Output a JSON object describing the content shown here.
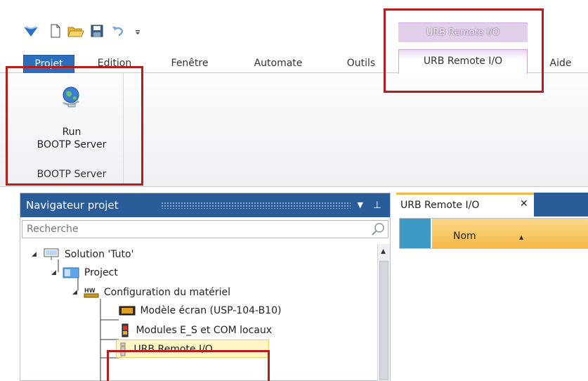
{
  "window": {
    "context_tab_group": "URB Remote I/O"
  },
  "ribbon_tabs": [
    {
      "label": "Projet"
    },
    {
      "label": "Edition"
    },
    {
      "label": "Fenêtre"
    },
    {
      "label": "Automate"
    },
    {
      "label": "Outils"
    },
    {
      "label": "URB Remote I/O"
    },
    {
      "label": "Aide"
    }
  ],
  "ribbon": {
    "button_line1": "Run",
    "button_line2": "BOOTP Server",
    "group_label": "BOOTP Server"
  },
  "navigator": {
    "title": "Navigateur projet",
    "search_placeholder": "Recherche",
    "tree": [
      {
        "label": "Solution 'Tuto'",
        "icon": "solution-icon"
      },
      {
        "label": "Project",
        "icon": "project-icon"
      },
      {
        "label": "Configuration du matériel",
        "icon": "hardware-config-icon"
      },
      {
        "label": "Modèle écran (USP-104-B10)",
        "icon": "screen-model-icon"
      },
      {
        "label": "Modules E_S et COM locaux",
        "icon": "local-modules-icon"
      },
      {
        "label": "URB Remote I/O",
        "icon": "remote-io-icon"
      }
    ]
  },
  "editor": {
    "doc_tab_label": "URB Remote I/O",
    "close_glyph": "✕",
    "column_header": "Nom"
  },
  "colors": {
    "accent_blue": "#2a6ebd",
    "panel_header": "#2a5c9a",
    "context_purple": "#c7a9d8",
    "highlight_red": "#b51c1c",
    "column_header_orange": "#f5b946"
  }
}
